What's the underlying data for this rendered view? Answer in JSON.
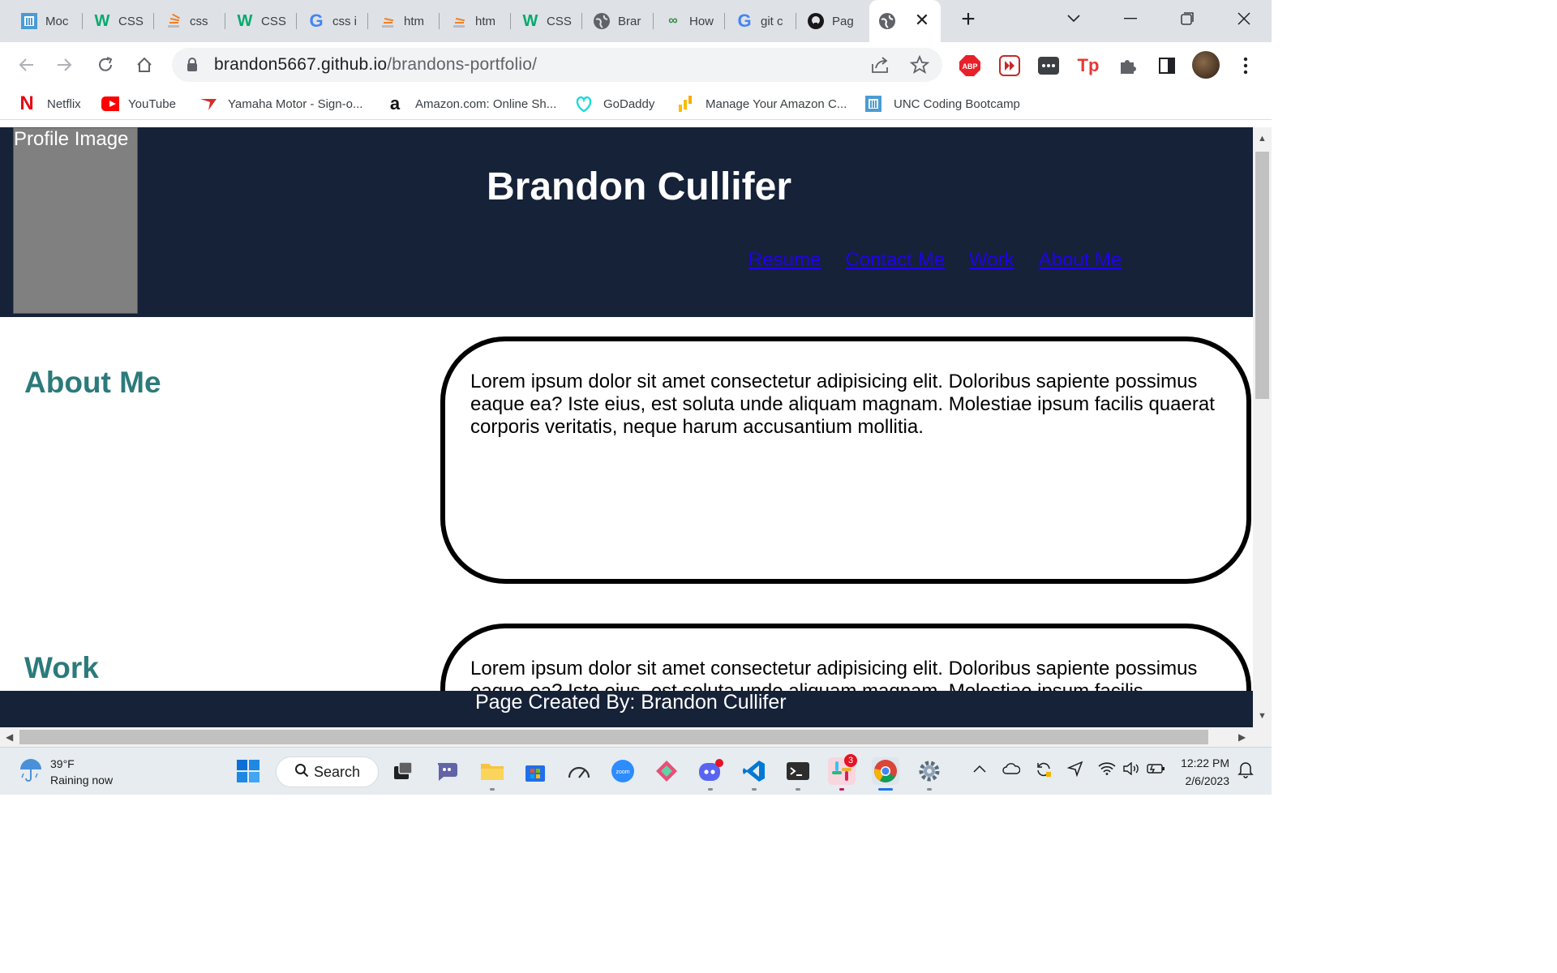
{
  "browser": {
    "tabs": [
      {
        "label": "Moc",
        "icon": "unc-icon"
      },
      {
        "label": "CSS",
        "icon": "w3schools-icon"
      },
      {
        "label": "css",
        "icon": "stackoverflow-icon"
      },
      {
        "label": "CSS",
        "icon": "w3schools-icon"
      },
      {
        "label": "css i",
        "icon": "google-icon"
      },
      {
        "label": "htm",
        "icon": "stackoverflow-icon"
      },
      {
        "label": "htm",
        "icon": "stackoverflow-icon"
      },
      {
        "label": "CSS",
        "icon": "w3schools-icon"
      },
      {
        "label": "Brar",
        "icon": "globe-icon"
      },
      {
        "label": "How",
        "icon": "geeksforgeeks-icon"
      },
      {
        "label": "git c",
        "icon": "google-icon"
      },
      {
        "label": "Pag",
        "icon": "github-icon"
      }
    ],
    "url_host": "brandon5667.github.io",
    "url_path": "/brandons-portfolio/",
    "extensions": [
      "ABP",
      "Tp"
    ],
    "bookmarks": [
      {
        "label": "Netflix",
        "icon": "netflix-icon"
      },
      {
        "label": "YouTube",
        "icon": "youtube-icon"
      },
      {
        "label": "Yamaha Motor - Sign-o...",
        "icon": "yamaha-icon"
      },
      {
        "label": "Amazon.com: Online Sh...",
        "icon": "amazon-icon"
      },
      {
        "label": "GoDaddy",
        "icon": "godaddy-icon"
      },
      {
        "label": "Manage Your Amazon C...",
        "icon": "analytics-icon"
      },
      {
        "label": "UNC Coding Bootcamp",
        "icon": "unc-icon"
      }
    ]
  },
  "site": {
    "profile_image_alt": "Profile Image",
    "title": "Brandon Cullifer",
    "nav": [
      "Resume",
      "Contact Me",
      "Work",
      "About Me"
    ],
    "sections": [
      {
        "heading": "About Me",
        "body": "Lorem ipsum dolor sit amet consectetur adipisicing elit. Doloribus sapiente possimus eaque ea? Iste eius, est soluta unde aliquam magnam. Molestiae ipsum facilis quaerat corporis veritatis, neque harum accusantium mollitia."
      },
      {
        "heading": "Work",
        "body": "Lorem ipsum dolor sit amet consectetur adipisicing elit. Doloribus sapiente possimus eaque ea? Iste eius, est soluta unde aliquam magnam. Molestiae ipsum facilis"
      }
    ],
    "footer": "Page Created By: Brandon Cullifer"
  },
  "taskbar": {
    "weather_temp": "39°F",
    "weather_desc": "Raining now",
    "search_label": "Search",
    "slack_badge": "3",
    "time": "12:22 PM",
    "date": "2/6/2023"
  },
  "colors": {
    "header_bg": "#152238",
    "heading_teal": "#2c7a7b",
    "link_blue": "#2200ee"
  }
}
